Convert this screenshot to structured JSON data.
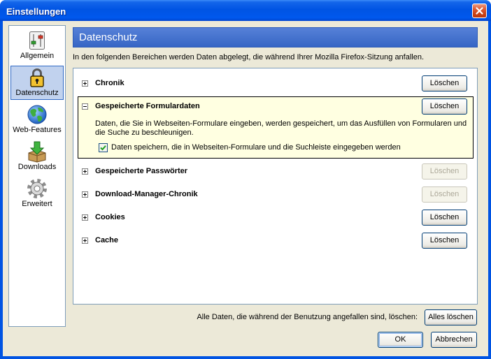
{
  "window": {
    "title": "Einstellungen",
    "close_icon": "close-icon"
  },
  "sidebar": {
    "items": [
      {
        "label": "Allgemein",
        "icon": "sliders-icon",
        "selected": false
      },
      {
        "label": "Datenschutz",
        "icon": "lock-icon",
        "selected": true
      },
      {
        "label": "Web-Features",
        "icon": "globe-icon",
        "selected": false
      },
      {
        "label": "Downloads",
        "icon": "download-box-icon",
        "selected": false
      },
      {
        "label": "Erweitert",
        "icon": "gear-icon",
        "selected": false
      }
    ]
  },
  "panel": {
    "title": "Datenschutz",
    "description": "In den folgenden Bereichen werden Daten abgelegt, die während Ihrer Mozilla Firefox-Sitzung anfallen.",
    "sections": [
      {
        "label": "Chronik",
        "expanded": false,
        "button_label": "Löschen",
        "button_enabled": true
      },
      {
        "label": "Gespeicherte Formulardaten",
        "expanded": true,
        "button_label": "Löschen",
        "button_enabled": true,
        "detail": "Daten, die Sie in Webseiten-Formulare eingeben, werden gespeichert, um das Ausfüllen von Formularen und die Suche zu beschleunigen.",
        "checkbox": {
          "label": "Daten speichern, die in Webseiten-Formulare und die Suchleiste eingegeben werden",
          "checked": true
        }
      },
      {
        "label": "Gespeicherte Passwörter",
        "expanded": false,
        "button_label": "Löschen",
        "button_enabled": false
      },
      {
        "label": "Download-Manager-Chronik",
        "expanded": false,
        "button_label": "Löschen",
        "button_enabled": false
      },
      {
        "label": "Cookies",
        "expanded": false,
        "button_label": "Löschen",
        "button_enabled": true
      },
      {
        "label": "Cache",
        "expanded": false,
        "button_label": "Löschen",
        "button_enabled": true
      }
    ]
  },
  "footer": {
    "clear_all_prompt": "Alle Daten, die während der Benutzung angefallen sind, löschen:",
    "clear_all_button": "Alles löschen",
    "ok_button": "OK",
    "cancel_button": "Abbrechen"
  },
  "colors": {
    "titlebar": "#0054E3",
    "client_background": "#ECE9D8",
    "panel_header": "#3A6CD1",
    "expanded_section_background": "#FFFFE1",
    "selection_background": "#C1D2EE",
    "selection_border": "#316AC5"
  }
}
